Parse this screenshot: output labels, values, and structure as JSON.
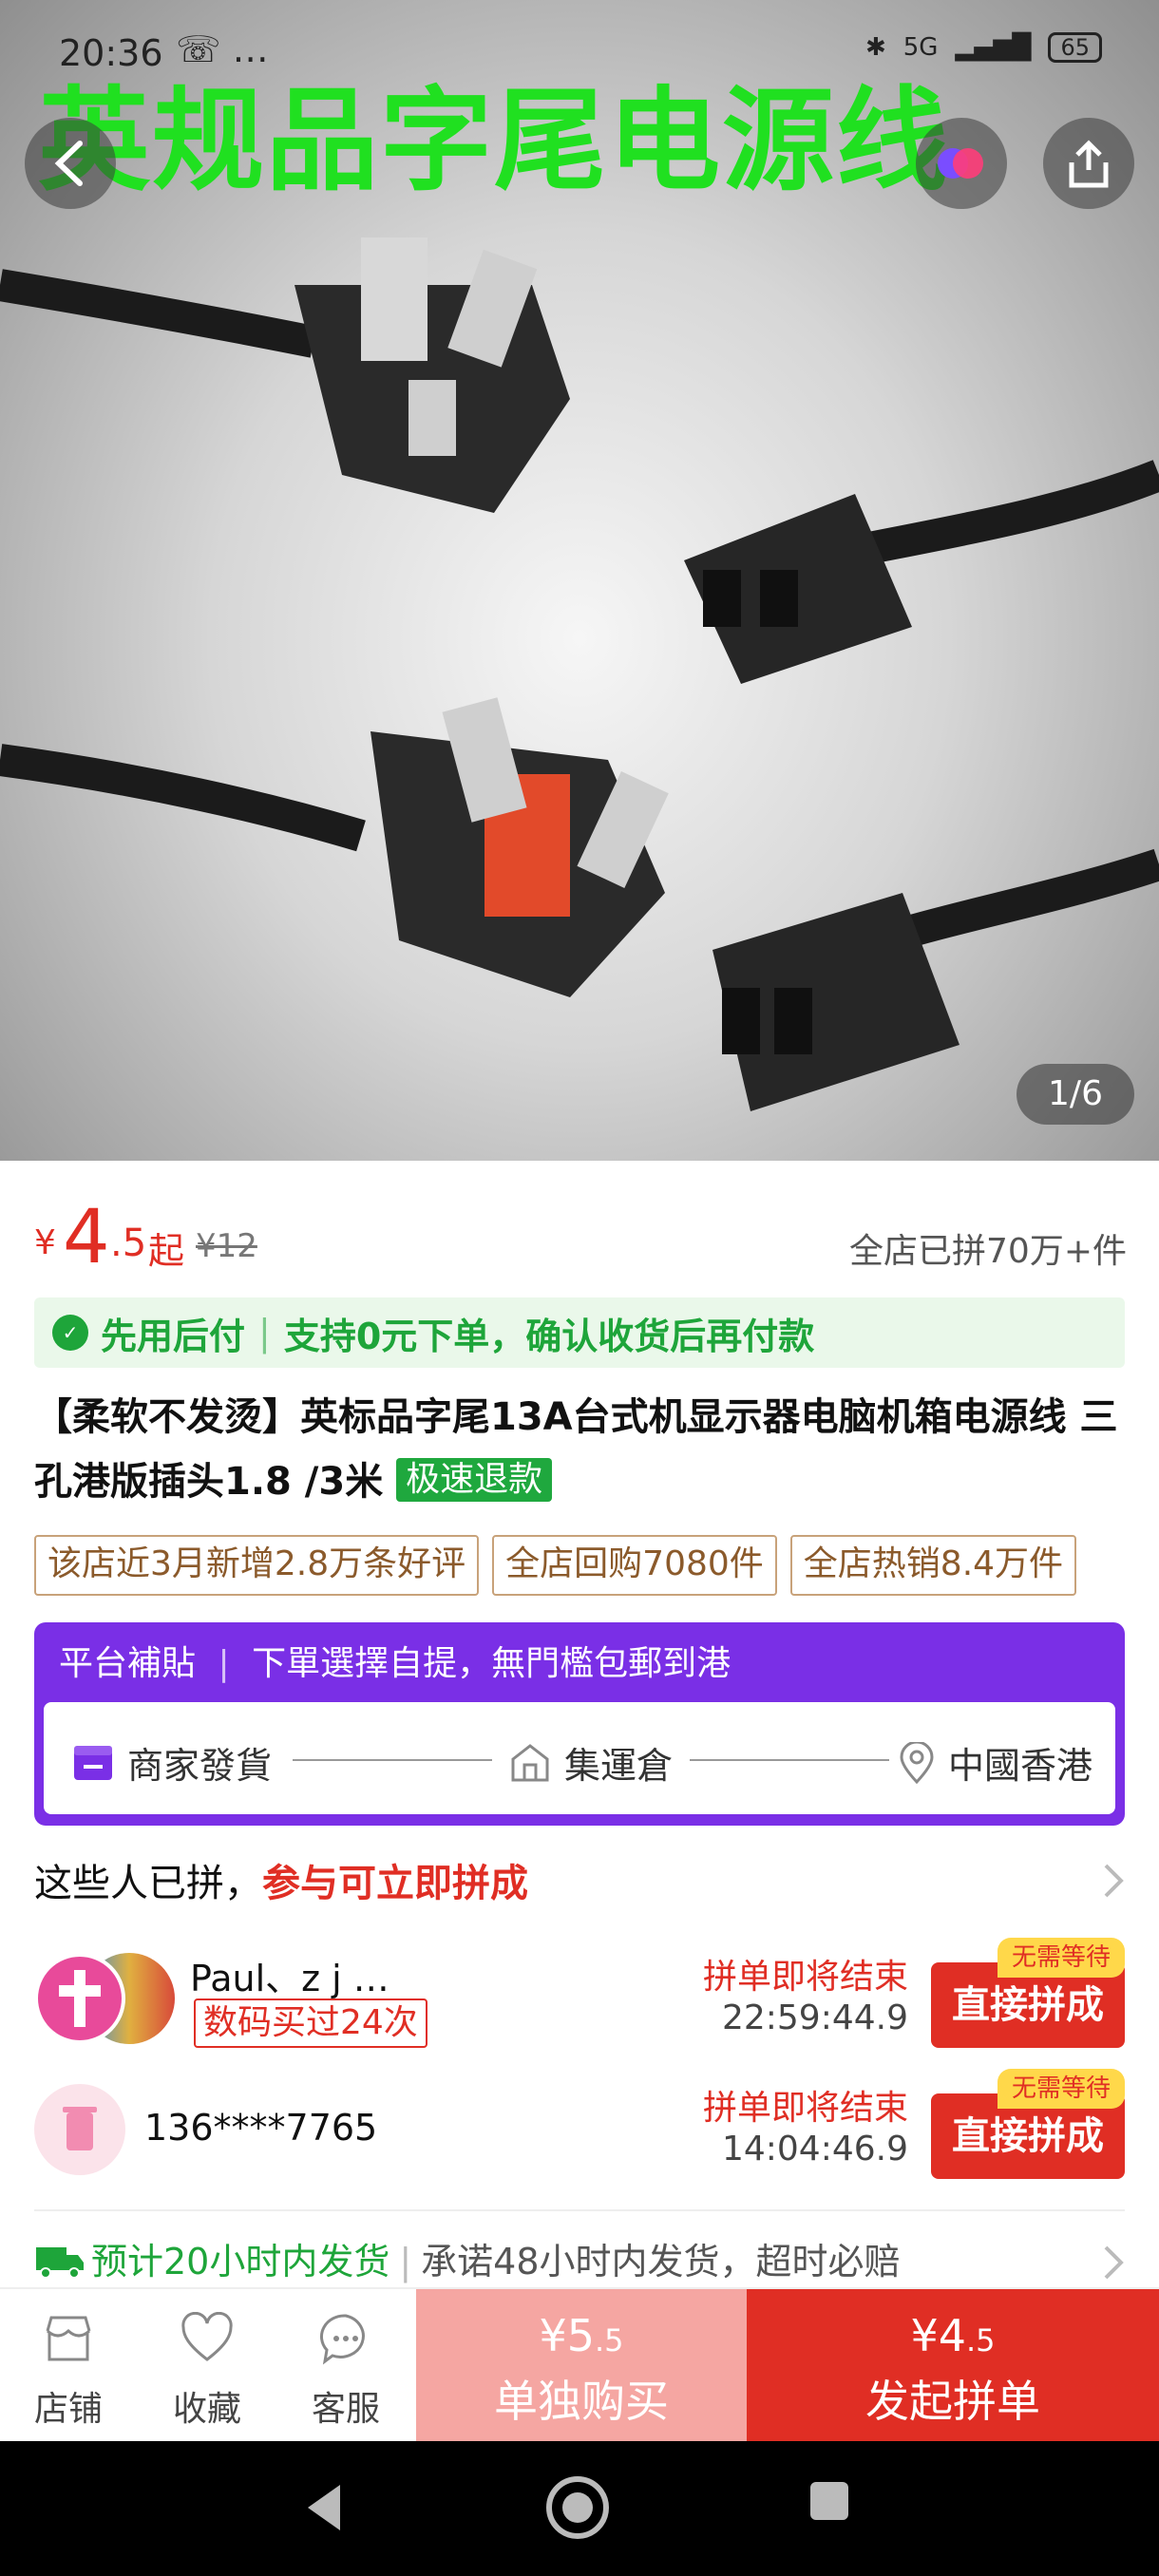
{
  "status": {
    "time": "20:36",
    "extra": "☏ …",
    "battery": "65",
    "network": "5G"
  },
  "hero": {
    "title_overlay": "英规品字尾电源线",
    "counter": "1/6"
  },
  "price": {
    "currency": "¥",
    "integer": "4",
    "decimal": ".5",
    "suffix": "起",
    "original": "¥12",
    "sold": "全店已拼70万+件"
  },
  "pay_later": {
    "part1": "先用后付",
    "part2": "支持0元下单，确认收货后再付款"
  },
  "product": {
    "title": "【柔软不发烫】英标品字尾13A台式机显示器电脑机箱电源线 三孔港版插头1.8 /3米",
    "fast_refund_tag": "极速退款"
  },
  "chips": [
    "该店近3月新增2.8万条好评",
    "全店回购7080件",
    "全店热销8.4万件"
  ],
  "subsidy": {
    "label": "平台補貼",
    "desc": "下單選擇自提，無門檻包郵到港",
    "steps": [
      "商家發貨",
      "集運倉",
      "中國香港"
    ]
  },
  "group": {
    "head_plain": "这些人已拼，",
    "head_red": "参与可立即拼成",
    "rows": [
      {
        "name": "Paul、z j …",
        "badge": "数码买过24次",
        "status": "拼单即将结束",
        "countdown": "22:59:44.9",
        "button": "直接拼成",
        "no_wait": "无需等待"
      },
      {
        "name": "136****7765",
        "badge": "",
        "status": "拼单即将结束",
        "countdown": "14:04:46.9",
        "button": "直接拼成",
        "no_wait": "无需等待"
      }
    ]
  },
  "shipping": {
    "green": "预计20小时内发货",
    "grey": "承诺48小时内发货，超时必赔"
  },
  "bottom": {
    "shop": "店铺",
    "favorite": "收藏",
    "service": "客服",
    "alone_price_int": "¥5",
    "alone_price_dec": ".5",
    "alone_label": "单独购买",
    "group_price_int": "¥4",
    "group_price_dec": ".5",
    "group_label": "发起拼单"
  },
  "colors": {
    "brand_red": "#e02e24",
    "purple": "#7a2fe6",
    "green": "#1ea53a"
  }
}
